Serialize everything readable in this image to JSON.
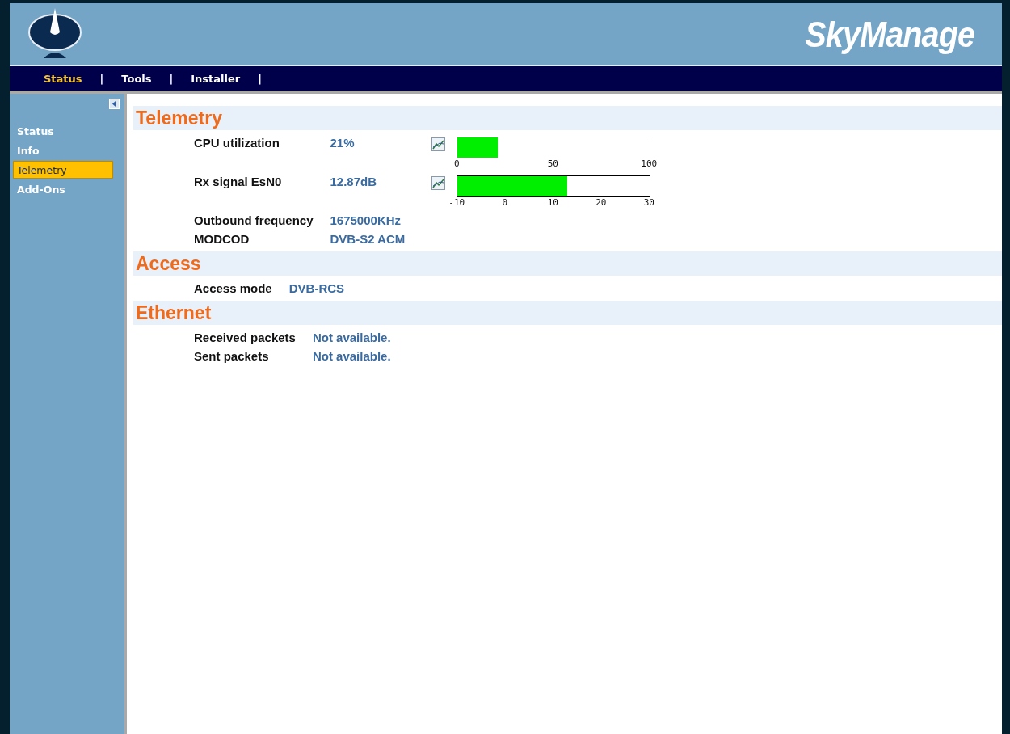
{
  "header": {
    "brand": "SkyManage"
  },
  "nav": [
    {
      "label": "Status",
      "selected": true,
      "separator": "|"
    },
    {
      "label": "Tools",
      "selected": false,
      "separator": "|"
    },
    {
      "label": "Installer",
      "selected": false,
      "separator": "|"
    }
  ],
  "sidebar": {
    "items": [
      {
        "label": "Status",
        "selected": false
      },
      {
        "label": "Info",
        "selected": false
      },
      {
        "label": "Telemetry",
        "selected": true
      },
      {
        "label": "Add-Ons",
        "selected": false
      }
    ]
  },
  "sections": [
    {
      "title": "Telemetry",
      "rows": [
        {
          "label": "CPU utilization",
          "value": "21%",
          "gauge": {
            "level": 0.21,
            "ticks": [
              "0",
              "50",
              "100"
            ]
          }
        },
        {
          "label": "Rx signal EsN0",
          "value": "12.87dB",
          "gauge": {
            "level": 0.57,
            "ticks": [
              "-10",
              "0",
              "10",
              "20",
              "30"
            ]
          }
        },
        {
          "label": "Outbound frequency",
          "value": "1675000KHz"
        },
        {
          "label": "MODCOD",
          "value": "DVB-S2 ACM"
        }
      ]
    },
    {
      "title": "Access",
      "rows": [
        {
          "label": "Access mode",
          "value": "DVB-RCS"
        }
      ]
    },
    {
      "title": "Ethernet",
      "rows": [
        {
          "label": "Received packets",
          "value": "Not available."
        },
        {
          "label": "Sent packets",
          "value": "Not available."
        }
      ]
    }
  ]
}
